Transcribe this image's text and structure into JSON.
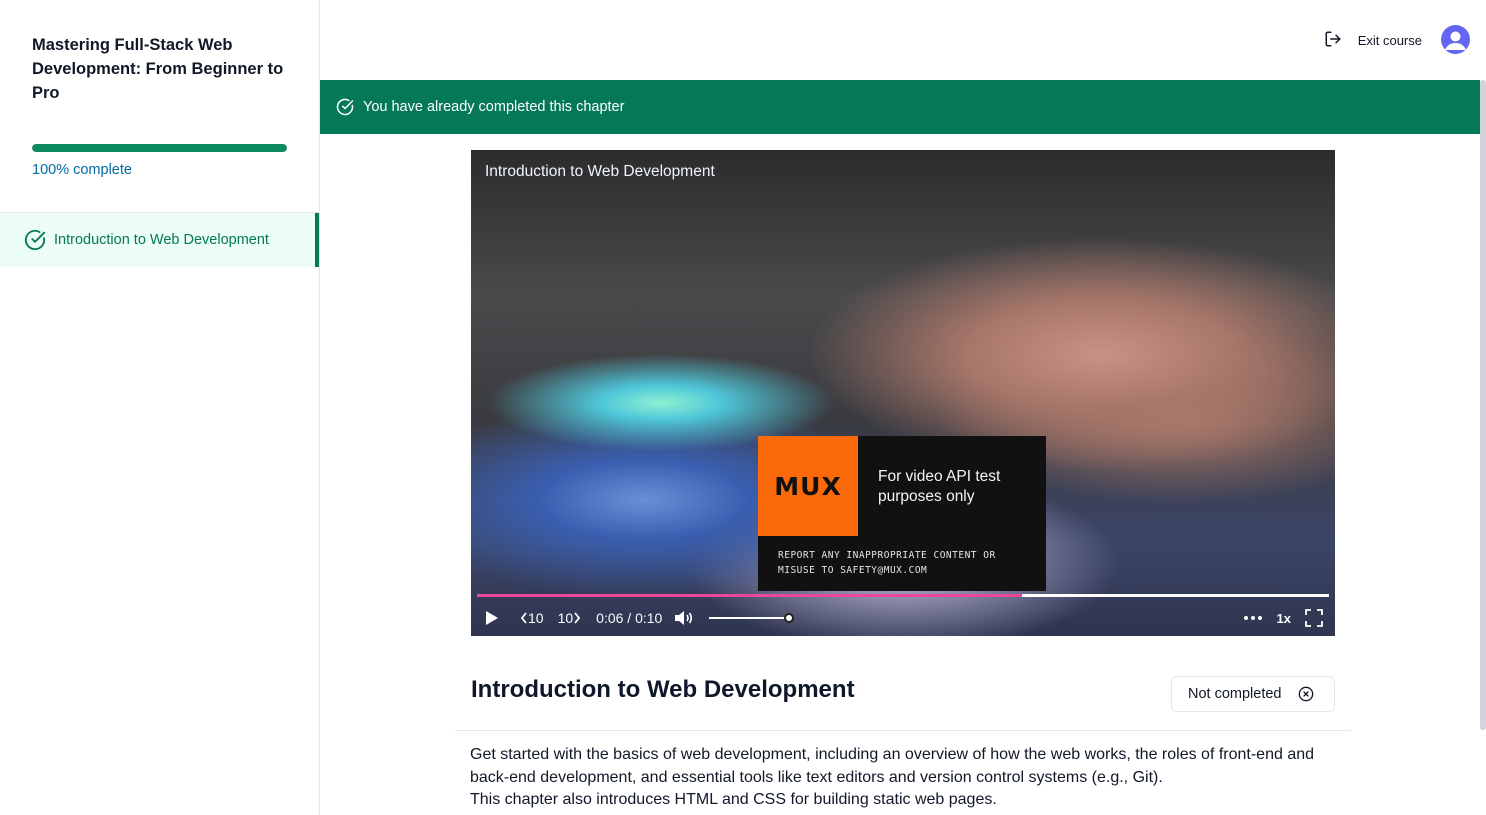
{
  "sidebar": {
    "course_title": "Mastering Full-Stack Web Development: From Beginner to Pro",
    "progress_percent": 100,
    "progress_label": "100% complete",
    "chapters": [
      {
        "label": "Introduction to Web Development",
        "icon": "check-circle-icon",
        "completed": true,
        "active": true
      }
    ]
  },
  "header": {
    "exit_label": "Exit course",
    "exit_icon": "log-out-icon",
    "avatar_icon": "user-avatar-icon"
  },
  "banner": {
    "text": "You have already completed this chapter",
    "icon": "check-circle-icon",
    "color": "#047857"
  },
  "player": {
    "title": "Introduction to Web Development",
    "watermark": {
      "logo_text": "MUX",
      "headline": "For video API test purposes only",
      "report_line_1": "REPORT ANY INAPPROPRIATE CONTENT OR",
      "report_line_2": "MISUSE TO SAFETY@MUX.COM"
    },
    "progress_fraction": 0.64,
    "time_display": "0:06 / 0:10",
    "skip_back_label": "10",
    "skip_forward_label": "10",
    "volume_fraction": 1.0,
    "playback_rate": "1x",
    "accent_color": "#ec4899"
  },
  "chapter": {
    "title": "Introduction to Web Development",
    "status_label": "Not completed",
    "status_icon": "x-circle-icon",
    "description_lines": [
      "Get started with the basics of web development, including an overview of how the web works, the roles of front-end and",
      "back-end development, and essential tools like text editors and version control systems (e.g., Git).",
      "This chapter also introduces HTML and CSS for building static web pages."
    ]
  }
}
